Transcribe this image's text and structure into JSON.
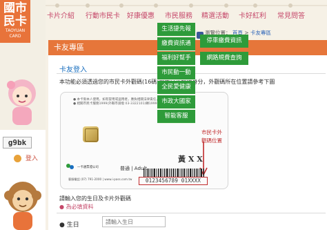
{
  "logo": {
    "text1": "國市",
    "text2": "民卡",
    "sub": "TAOYUAN CARD"
  },
  "nav": {
    "items": [
      "卡片介紹",
      "行動市民卡",
      "好康優惠",
      "市民服務",
      "精選活動",
      "卡好紅利",
      "常見問答"
    ]
  },
  "submenu": {
    "items": [
      "生活捷先報",
      "繳費資訊通",
      "福利好幫手",
      "市民動一動",
      "全民愛健康",
      "市政大國家",
      "智能客服"
    ]
  },
  "submenu2": {
    "items": [
      "停車繳費資訊",
      "網路規費查詢"
    ]
  },
  "breadcrumb": {
    "prefix": "瀏覽位置：",
    "home": "首頁",
    "sep": ">",
    "current": "卡友專區"
  },
  "main": {
    "header": "卡友專區",
    "section_title": "卡友登入",
    "intro": "本功能必須透過您的市民卡外觀碼(16碼)與生日來驗證身分，外觀碼所在位置請參考下圖"
  },
  "card": {
    "note_line1": "● 本卡限本人使用，如有冒用或盜用者，應負相關法律責任，請善加保管。",
    "note_line2": "● 相關市民卡服務1999(外縣市請撥 03-3322101)轉1999...",
    "company": "一卡通票證公司",
    "normal": "普通 | Adult",
    "phone": "客服電話 (07) 791-2000 | www.i-pass.com.tw",
    "id_text": "黃 X X",
    "annot_line1": "市民卡外",
    "annot_line2": "觀碼位置",
    "serial": "0123456789 01XXXX"
  },
  "below": {
    "line1": "請輸入您的生日及卡片外觀碼",
    "line2": "● 為必填資料"
  },
  "dob": {
    "label": "● 生日",
    "placeholder": "請輸入生日"
  },
  "login": {
    "captcha": "g9bk",
    "label": "登入"
  },
  "colors": {
    "accent_orange": "#e6763a",
    "accent_green": "#2e9b3a",
    "nav_pink": "#c5486a",
    "annot_red": "#c0292b"
  }
}
